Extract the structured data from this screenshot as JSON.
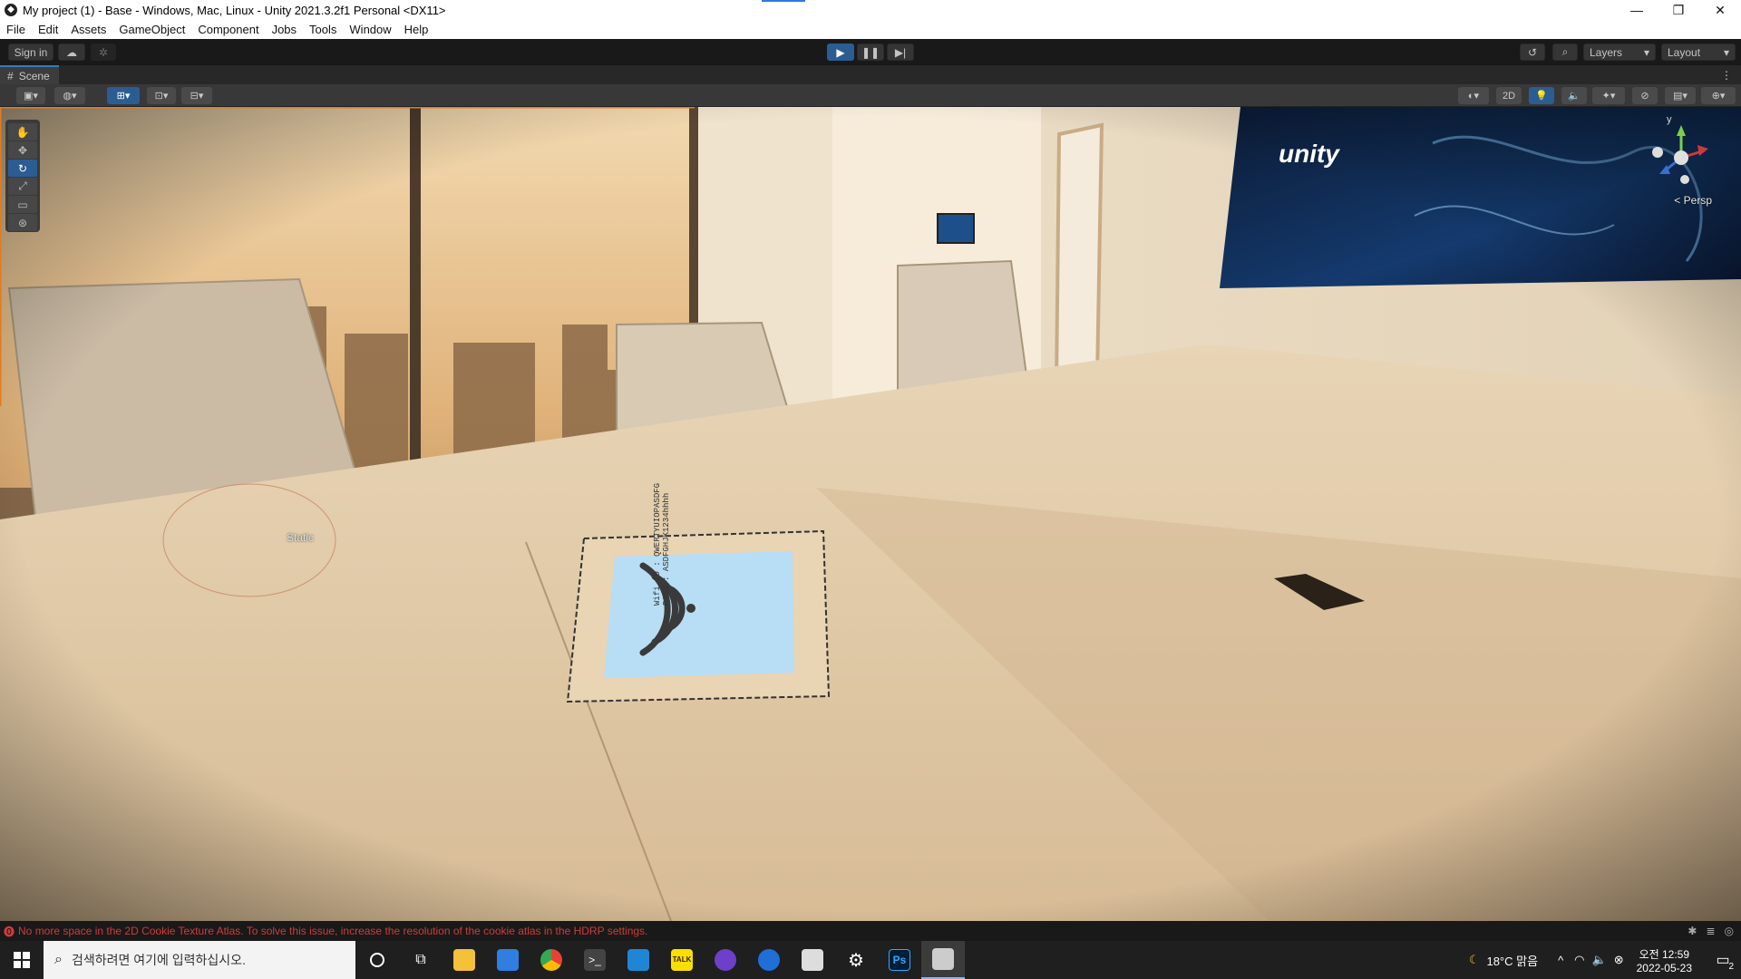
{
  "window": {
    "title": "My project (1) - Base - Windows, Mac, Linux - Unity 2021.3.2f1 Personal <DX11>",
    "app_icon": "unity-logo-icon"
  },
  "menu": [
    "File",
    "Edit",
    "Assets",
    "GameObject",
    "Component",
    "Jobs",
    "Tools",
    "Window",
    "Help"
  ],
  "toolbar": {
    "sign_in": "Sign in",
    "layers": "Layers",
    "layout": "Layout"
  },
  "scene_tab": {
    "label": "Scene"
  },
  "overlay": {
    "mode_2d": "2D"
  },
  "viewport": {
    "persp_label": "< Persp",
    "gizmo_y": "y",
    "static_label": "Static",
    "tv_logo_text": "unity",
    "wifi_id": "Wifi ID : QWERTYUIOPASDFG",
    "wifi_pass": "PASS : ASDFGHJK1234hhhh"
  },
  "status": {
    "message": "No more space in the 2D Cookie Texture Atlas. To solve this issue, increase the resolution of the cookie atlas in the HDRP settings.",
    "color": "#d23a3a"
  },
  "taskbar": {
    "search_placeholder": "검색하려면 여기에 입력하십시오.",
    "weather": "18°C 맑음",
    "time": "오전 12:59",
    "date": "2022-05-23",
    "notification_count": "2",
    "ps_label": "Ps",
    "talk_label": "TALK"
  }
}
